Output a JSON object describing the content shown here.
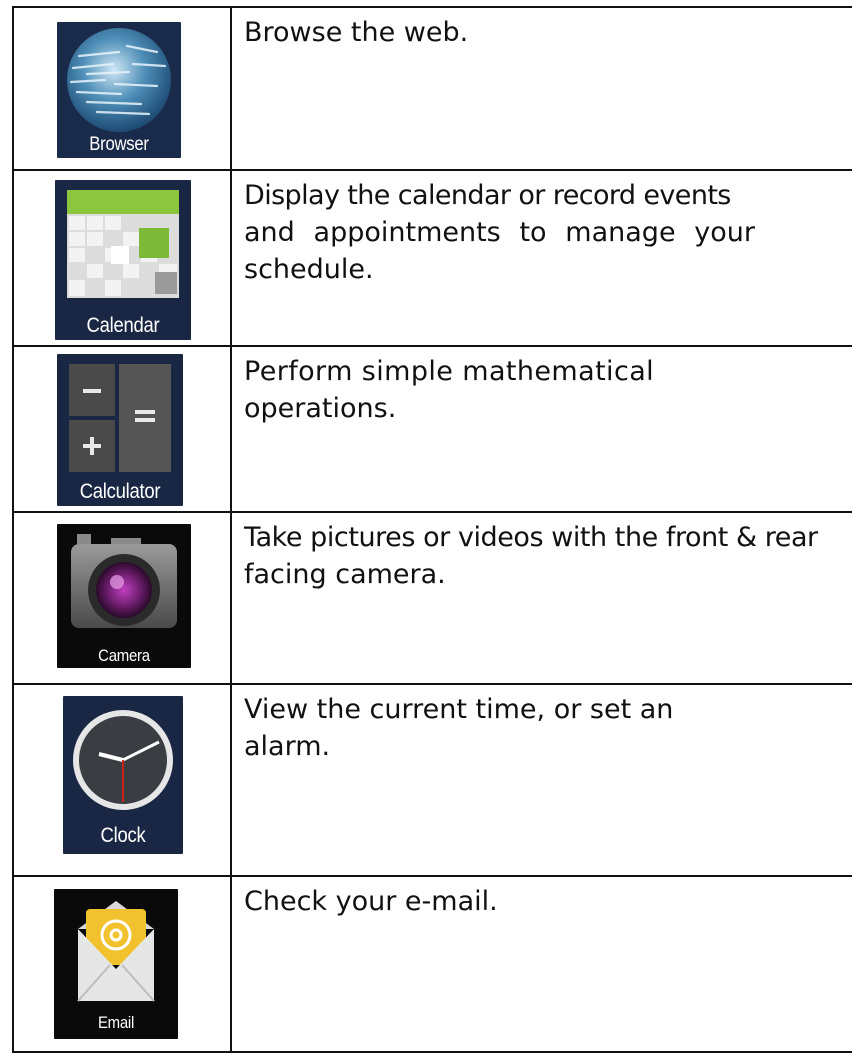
{
  "apps": [
    {
      "icon": "browser-icon",
      "caption": "Browser",
      "description": [
        "Browse the web."
      ]
    },
    {
      "icon": "calendar-icon",
      "caption": "Calendar",
      "description": [
        "Display the calendar or record events",
        "and appointments to manage your",
        "schedule."
      ]
    },
    {
      "icon": "calculator-icon",
      "caption": "Calculator",
      "description": [
        "Perform simple mathematical",
        "operations."
      ]
    },
    {
      "icon": "camera-icon",
      "caption": "Camera",
      "description": [
        "Take pictures or videos with the front & rear",
        "facing camera."
      ]
    },
    {
      "icon": "clock-icon",
      "caption": "Clock",
      "description": [
        "View the current time, or set an",
        "alarm."
      ]
    },
    {
      "icon": "email-icon",
      "caption": "Email",
      "description": [
        "Check your e-mail."
      ]
    }
  ],
  "colors": {
    "icon_navy": "#1a2744",
    "icon_black": "#0a0a0a",
    "calendar_green": "#8cc63f",
    "email_yellow": "#f2c12e",
    "border": "#111111"
  }
}
